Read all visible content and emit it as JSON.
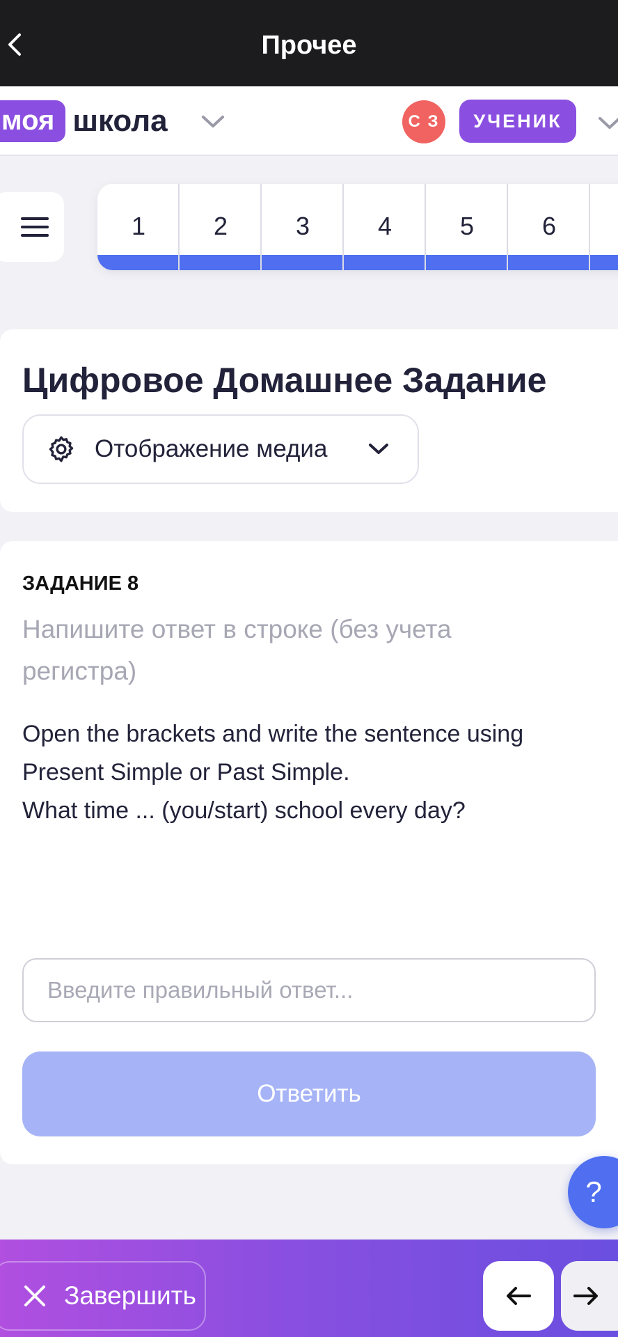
{
  "topbar": {
    "title": "Прочее",
    "back_icon": "chevron-left-icon"
  },
  "header": {
    "logo_part1": "моя",
    "logo_part2": "школа",
    "avatar_initials": "С З",
    "role": "УЧЕНИК"
  },
  "tasks": {
    "items": [
      {
        "label": "1"
      },
      {
        "label": "2"
      },
      {
        "label": "3"
      },
      {
        "label": "4"
      },
      {
        "label": "5"
      },
      {
        "label": "6"
      },
      {
        "label": ""
      }
    ],
    "bar_color": "#4f6ff0"
  },
  "main": {
    "title": "Цифровое Домашнее Задание",
    "media_button": "Отображение медиа"
  },
  "task_card": {
    "label": "ЗАДАНИЕ 8",
    "hint": "Напишите ответ в строке (без учета регистра)",
    "question_line1": "Open the brackets and write the sentence using",
    "question_line2": "Present Simple or Past Simple.",
    "question_line3": "What time ... (you/start) school every day?",
    "answer_placeholder": "Введите правильный ответ...",
    "answer_value": "",
    "submit_label": "Ответить"
  },
  "help": {
    "label": "?"
  },
  "footer": {
    "finish_label": "Завершить"
  },
  "colors": {
    "accent": "#8a4fe0",
    "primary": "#4f6ff0",
    "avatar": "#f06360"
  }
}
